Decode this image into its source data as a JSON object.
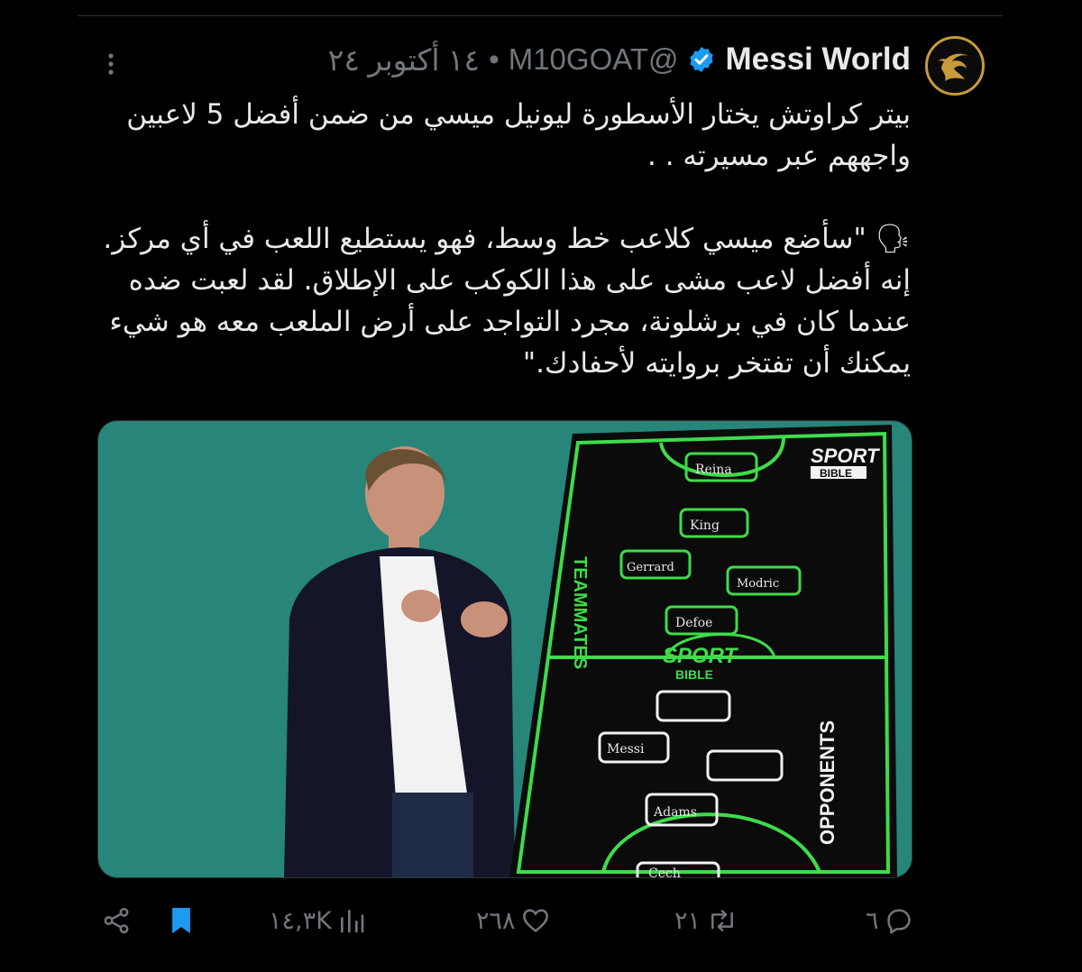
{
  "tweet": {
    "author_name": "Messi World",
    "handle": "@M10GOAT",
    "separator": "•",
    "date": "١٤ أكتوبر ٢٤",
    "text": "بيتر كراوتش يختار الأسطورة ليونيل ميسي من ضمن أفضل 5 لاعبين واجههم عبر مسيرته . .\n\n🗣 \"سأضع ميسي كلاعب خط وسط، فهو يستطيع اللعب في أي مركز. إنه أفضل لاعب مشى على هذا الكوكب على الإطلاق. لقد لعبت ضده عندما كان في برشلونة، مجرد التواجد على أرض الملعب معه هو شيء يمكنك أن تفتخر بروايته لأحفادك.\"",
    "media": {
      "board_left_label": "TEAMMATES",
      "board_right_label": "OPPONENTS",
      "brand_top": "SPORT",
      "brand_bottom": "BIBLE",
      "teammates": [
        "Reina",
        "King",
        "Gerrard",
        "Modric",
        "Defoe"
      ],
      "opponents": [
        "",
        "Messi",
        "",
        "Adams",
        "Cech"
      ]
    },
    "actions": {
      "replies": "٦",
      "retweets": "٢١",
      "likes": "٢٦٨",
      "views": "١٤,٣K"
    }
  },
  "icons": {
    "verified": "verified-badge-icon",
    "more": "more-dots-icon",
    "reply": "reply-icon",
    "retweet": "retweet-icon",
    "like": "heart-icon",
    "views": "views-chart-icon",
    "bookmark": "bookmark-icon",
    "share": "share-icon"
  },
  "colors": {
    "background": "#000000",
    "text": "#e7e9ea",
    "muted": "#71767b",
    "verified": "#1d9bf0",
    "bookmark": "#1d9bf0",
    "board_green": "#3ddc4a",
    "wall_teal": "#2a8d80",
    "avatar_gold": "#c79a3c"
  }
}
